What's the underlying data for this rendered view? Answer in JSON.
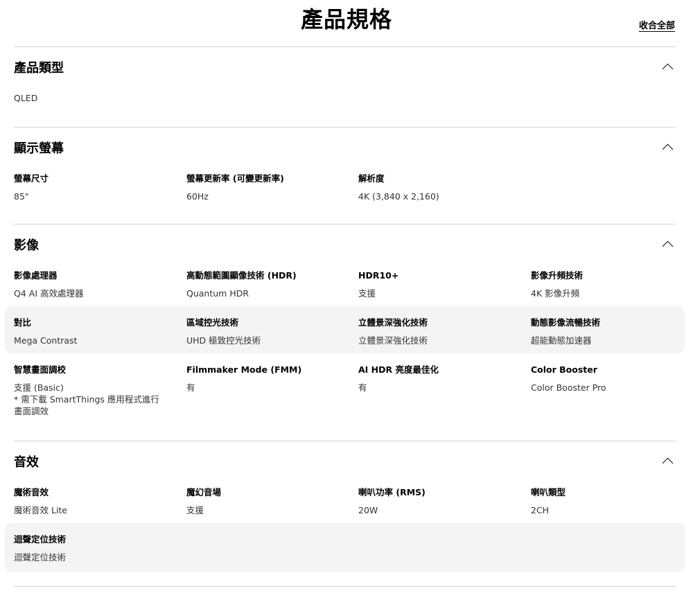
{
  "header": {
    "title": "產品規格",
    "collapse_all": "收合全部"
  },
  "sections": {
    "product_type": {
      "title": "產品類型",
      "value": "QLED"
    },
    "display": {
      "title": "顯示螢幕",
      "specs": [
        {
          "label": "螢幕尺寸",
          "value": "85\""
        },
        {
          "label": "螢幕更新率 (可變更新率)",
          "value": "60Hz"
        },
        {
          "label": "解析度",
          "value": "4K (3,840 x 2,160)"
        }
      ]
    },
    "video": {
      "title": "影像",
      "specs": [
        {
          "label": "影像處理器",
          "value": "Q4 AI 高效處理器"
        },
        {
          "label": "高動態範圍顯像技術 (HDR)",
          "value": "Quantum HDR"
        },
        {
          "label": "HDR10+",
          "value": "支援"
        },
        {
          "label": "影像升頻技術",
          "value": "4K 影像升頻"
        },
        {
          "label": "對比",
          "value": "Mega Contrast"
        },
        {
          "label": "區域控光技術",
          "value": "UHD 極致控光技術"
        },
        {
          "label": "立體景深強化技術",
          "value": "立體景深強化技術"
        },
        {
          "label": "動態影像流暢技術",
          "value": "超能動態加速器"
        },
        {
          "label": "智慧畫面調校",
          "value": "支援 (Basic)\n* 需下載 SmartThings 應用程式進行\n畫面調效"
        },
        {
          "label": "Filmmaker Mode (FMM)",
          "value": "有"
        },
        {
          "label": "AI HDR 亮度最佳化",
          "value": "有"
        },
        {
          "label": "Color Booster",
          "value": "Color Booster Pro"
        }
      ]
    },
    "audio": {
      "title": "音效",
      "specs": [
        {
          "label": "魔術音效",
          "value": "魔術音效 Lite"
        },
        {
          "label": "魔幻音場",
          "value": "支援"
        },
        {
          "label": "喇叭功率 (RMS)",
          "value": "20W"
        },
        {
          "label": "喇叭類型",
          "value": "2CH"
        },
        {
          "label": "迴聲定位技術",
          "value": "迴聲定位技術"
        }
      ]
    }
  }
}
